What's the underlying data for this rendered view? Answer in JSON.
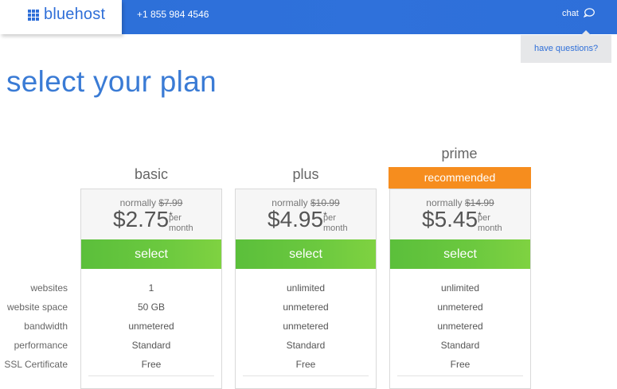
{
  "header": {
    "brand": "bluehost",
    "phone": "+1 855 984 4546",
    "chat_label": "chat",
    "help_label": "have questions?"
  },
  "page": {
    "title": "select your plan"
  },
  "features": [
    "websites",
    "website space",
    "bandwidth",
    "performance",
    "SSL Certificate"
  ],
  "plans": [
    {
      "name": "basic",
      "normally_label": "normally",
      "old_price": "$7.99",
      "price": "$2.75",
      "asterisk": "*",
      "per": "per",
      "month": "month",
      "select_label": "select",
      "values": [
        "1",
        "50 GB",
        "unmetered",
        "Standard",
        "Free"
      ]
    },
    {
      "name": "plus",
      "normally_label": "normally",
      "old_price": "$10.99",
      "price": "$4.95",
      "asterisk": "*",
      "per": "per",
      "month": "month",
      "select_label": "select",
      "values": [
        "unlimited",
        "unmetered",
        "unmetered",
        "Standard",
        "Free"
      ]
    },
    {
      "name": "prime",
      "badge": "recommended",
      "normally_label": "normally",
      "old_price": "$14.99",
      "price": "$5.45",
      "asterisk": "*",
      "per": "per",
      "month": "month",
      "select_label": "select",
      "values": [
        "unlimited",
        "unmetered",
        "unmetered",
        "Standard",
        "Free"
      ]
    }
  ],
  "colors": {
    "brand_blue": "#2f6fd8",
    "select_green": "#6cc93f",
    "recommended_orange": "#f68d1e"
  }
}
